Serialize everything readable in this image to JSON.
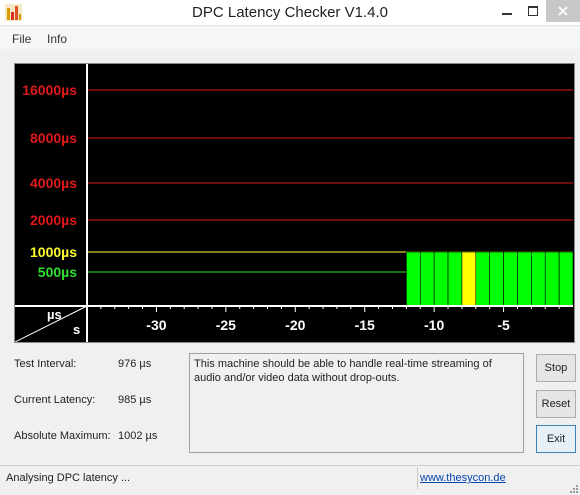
{
  "window": {
    "title": "DPC Latency Checker V1.4.0",
    "icon": "app-bars-icon"
  },
  "menu": {
    "items": [
      "File",
      "Info"
    ]
  },
  "chart_data": {
    "type": "bar",
    "x_axis_label": "s",
    "y_axis_label": "µs",
    "x_ticks": [
      -30,
      -25,
      -20,
      -15,
      -10,
      -5
    ],
    "xlim": [
      -35,
      0
    ],
    "y_levels": [
      {
        "label": "16000µs",
        "color": "#e01818"
      },
      {
        "label": "8000µs",
        "color": "#e01818"
      },
      {
        "label": "4000µs",
        "color": "#e01818"
      },
      {
        "label": "2000µs",
        "color": "#e01818"
      },
      {
        "label": "1000µs",
        "color": "#ffff30"
      },
      {
        "label": "500µs",
        "color": "#30e030"
      }
    ],
    "bars": [
      {
        "x": -11.5,
        "level": "1000µs",
        "color": "#00ff00"
      },
      {
        "x": -10.5,
        "level": "1000µs",
        "color": "#00ff00"
      },
      {
        "x": -9.5,
        "level": "1000µs",
        "color": "#00ff00"
      },
      {
        "x": -8.5,
        "level": "1000µs",
        "color": "#00ff00"
      },
      {
        "x": -7.5,
        "level": "1000µs",
        "color": "#ffff00"
      },
      {
        "x": -6.5,
        "level": "1000µs",
        "color": "#00ff00"
      },
      {
        "x": -5.5,
        "level": "1000µs",
        "color": "#00ff00"
      },
      {
        "x": -4.5,
        "level": "1000µs",
        "color": "#00ff00"
      },
      {
        "x": -3.5,
        "level": "1000µs",
        "color": "#00ff00"
      },
      {
        "x": -2.5,
        "level": "1000µs",
        "color": "#00ff00"
      },
      {
        "x": -1.5,
        "level": "1000µs",
        "color": "#00ff00"
      },
      {
        "x": -0.5,
        "level": "1000µs",
        "color": "#00ff00"
      }
    ]
  },
  "stats": {
    "test_interval_label": "Test Interval:",
    "test_interval_value": "976 µs",
    "current_latency_label": "Current Latency:",
    "current_latency_value": "985 µs",
    "absolute_max_label": "Absolute Maximum:",
    "absolute_max_value": "1002 µs"
  },
  "message": "This machine should be able to handle real-time streaming of audio and/or video data without drop-outs.",
  "buttons": {
    "stop": "Stop",
    "reset": "Reset",
    "exit": "Exit"
  },
  "status": {
    "text": "Analysing DPC latency ...",
    "link": "www.thesycon.de"
  }
}
